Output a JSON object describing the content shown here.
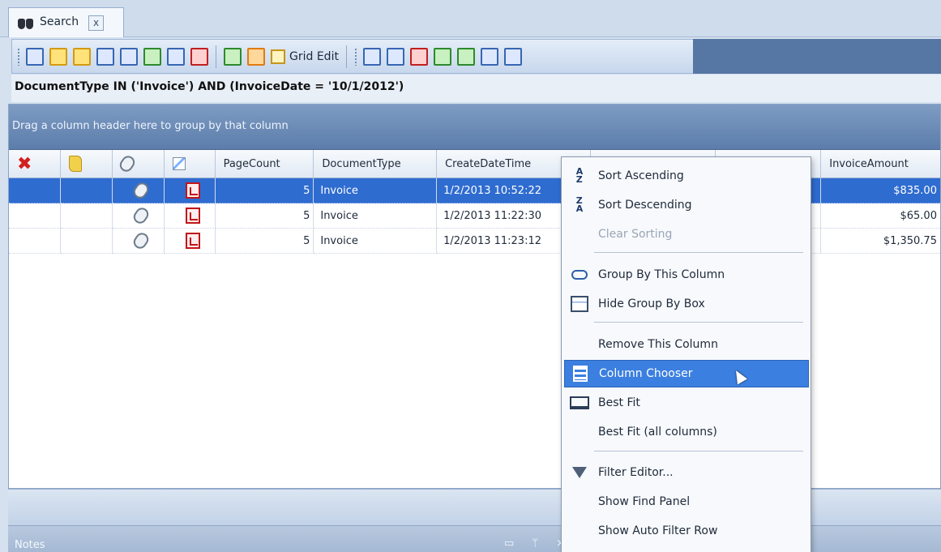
{
  "tab": {
    "label": "Search",
    "close": "x"
  },
  "toolbar": {
    "grid_edit_label": "Grid Edit"
  },
  "filter_text": "DocumentType IN ('Invoice') AND (InvoiceDate = '10/1/2012')",
  "grid": {
    "group_hint": "Drag a column header here to group by that column",
    "columns": [
      "",
      "",
      "",
      "",
      "PageCount",
      "DocumentType",
      "CreateDateTime",
      "",
      "",
      "InvoiceAmount"
    ],
    "rows": [
      {
        "page_count": "5",
        "doc_type": "Invoice",
        "create": "1/2/2013 10:52:22",
        "amount": "$835.00"
      },
      {
        "page_count": "5",
        "doc_type": "Invoice",
        "create": "1/2/2013 11:22:30",
        "amount": "$65.00"
      },
      {
        "page_count": "5",
        "doc_type": "Invoice",
        "create": "1/2/2013 11:23:12",
        "amount": "$1,350.75"
      }
    ]
  },
  "notes_bar": {
    "label": "Notes",
    "ctrl_min": "▭",
    "ctrl_pin": "ᛘ",
    "ctrl_close": "×"
  },
  "menu": {
    "sort_asc": "Sort Ascending",
    "sort_desc": "Sort Descending",
    "clear_sort": "Clear Sorting",
    "group_by": "Group By This Column",
    "hide_group_box": "Hide Group By Box",
    "remove_column": "Remove This Column",
    "column_chooser": "Column Chooser",
    "best_fit": "Best Fit",
    "best_fit_all": "Best Fit (all columns)",
    "filter_editor": "Filter Editor...",
    "show_find": "Show Find Panel",
    "show_auto_filter": "Show Auto Filter Row"
  }
}
